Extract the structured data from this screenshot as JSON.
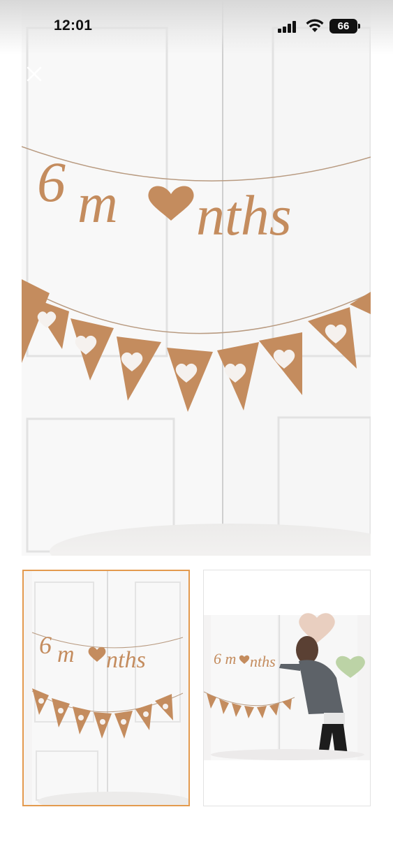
{
  "status_bar": {
    "time": "12:01",
    "battery_level": "66",
    "icons": [
      "signal-icon",
      "wifi-icon",
      "battery-icon"
    ]
  },
  "viewer": {
    "close_icon": "close-icon",
    "main_image": {
      "banner_text": "6 m♥nths",
      "description_icon": "garland-photo"
    }
  },
  "thumbnails": [
    {
      "banner_text": "6 m♥nths",
      "selected": true
    },
    {
      "banner_text": "6 m♥nths",
      "selected": false
    }
  ],
  "colors": {
    "accent_border": "#e39a4e",
    "kraft": "#c79063",
    "door_white": "#f7f7f7"
  }
}
